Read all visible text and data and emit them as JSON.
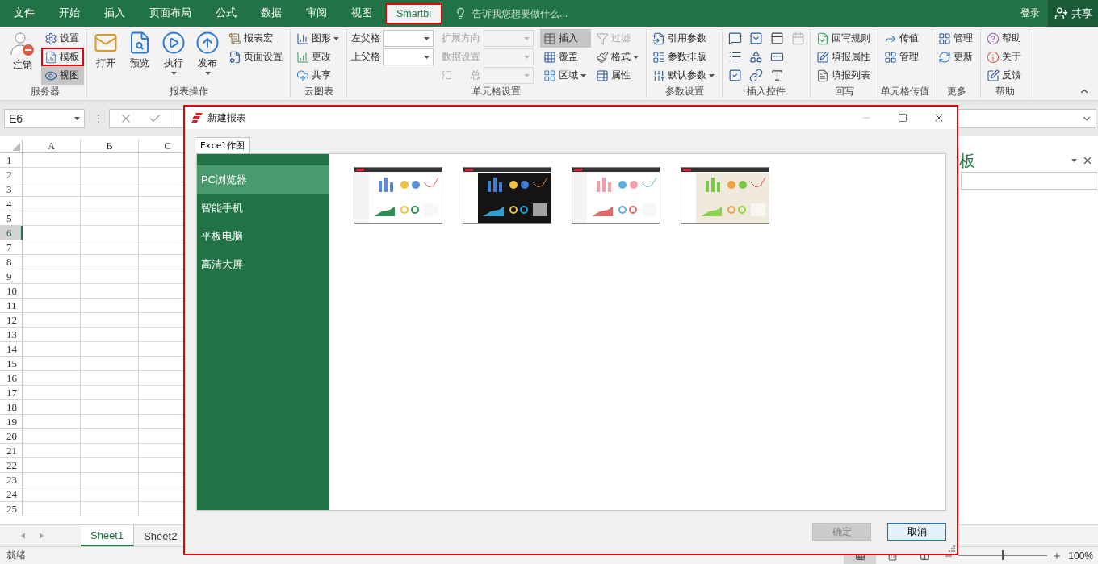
{
  "title_tabs": [
    {
      "label": "文件",
      "selected": false
    },
    {
      "label": "开始",
      "selected": false
    },
    {
      "label": "插入",
      "selected": false
    },
    {
      "label": "页面布局",
      "selected": false
    },
    {
      "label": "公式",
      "selected": false
    },
    {
      "label": "数据",
      "selected": false
    },
    {
      "label": "审阅",
      "selected": false
    },
    {
      "label": "视图",
      "selected": false
    },
    {
      "label": "Smartbi",
      "selected": true,
      "highlighted": true
    }
  ],
  "tell_me": {
    "placeholder": "告诉我您想要做什么..."
  },
  "account": {
    "sign_in": "登录",
    "share": "共享"
  },
  "ribbon": {
    "groups": [
      {
        "label": "服务器",
        "columns": [
          [
            {
              "kind": "large",
              "label": "注销"
            }
          ],
          [
            {
              "kind": "small",
              "label": "设置"
            },
            {
              "kind": "small",
              "label": "模板",
              "highlighted": true
            },
            {
              "kind": "small",
              "label": "视图",
              "pressed": true
            }
          ]
        ]
      },
      {
        "label": "报表操作",
        "columns": [
          [
            {
              "kind": "large",
              "label": "打开"
            }
          ],
          [
            {
              "kind": "large",
              "label": "预览"
            }
          ],
          [
            {
              "kind": "large",
              "label": "执行",
              "dropdown": true
            }
          ],
          [
            {
              "kind": "large",
              "label": "发布",
              "dropdown": true
            }
          ],
          [
            {
              "kind": "small",
              "label": "报表宏"
            },
            {
              "kind": "small",
              "label": "页面设置"
            }
          ]
        ]
      },
      {
        "label": "云图表",
        "columns": [
          [
            {
              "kind": "small",
              "label": "图形",
              "dropdown": true
            },
            {
              "kind": "small",
              "label": "更改"
            },
            {
              "kind": "small",
              "label": "共享"
            }
          ]
        ]
      },
      {
        "label": "单元格设置",
        "columns": [
          [
            {
              "kind": "combo",
              "label": "左父格"
            },
            {
              "kind": "combo",
              "label": "上父格"
            }
          ],
          [
            {
              "kind": "combo",
              "label": "扩展方向",
              "disabled": true
            },
            {
              "kind": "combo",
              "label": "数据设置",
              "disabled": true
            },
            {
              "kind": "combo",
              "label": "汇　　总",
              "disabled": true
            }
          ],
          [
            {
              "kind": "small",
              "label": "插入",
              "pressed": true
            },
            {
              "kind": "small",
              "label": "覆盖"
            },
            {
              "kind": "small",
              "label": "区域",
              "dropdown": true
            }
          ],
          [
            {
              "kind": "small",
              "label": "过滤",
              "disabled": true
            },
            {
              "kind": "small",
              "label": "格式",
              "dropdown": true
            },
            {
              "kind": "small",
              "label": "属性"
            }
          ]
        ]
      },
      {
        "label": "参数设置",
        "columns": [
          [
            {
              "kind": "small",
              "label": "引用参数"
            },
            {
              "kind": "small",
              "label": "参数排版"
            },
            {
              "kind": "small",
              "label": "默认参数",
              "dropdown": true
            }
          ]
        ]
      },
      {
        "label": "插入控件",
        "columns": [
          [
            {
              "kind": "icon"
            },
            {
              "kind": "icon"
            },
            {
              "kind": "icon"
            }
          ],
          [
            {
              "kind": "icon"
            },
            {
              "kind": "icon"
            },
            {
              "kind": "icon"
            }
          ],
          [
            {
              "kind": "icon"
            },
            {
              "kind": "icon"
            },
            {
              "kind": "icon"
            }
          ],
          [
            {
              "kind": "icon",
              "disabled": true
            }
          ]
        ]
      },
      {
        "label": "回写",
        "columns": [
          [
            {
              "kind": "small",
              "label": "回写规则"
            },
            {
              "kind": "small",
              "label": "填报属性"
            },
            {
              "kind": "small",
              "label": "填报列表"
            }
          ]
        ]
      },
      {
        "label": "单元格传值",
        "columns": [
          [
            {
              "kind": "small",
              "label": "传值"
            },
            {
              "kind": "small",
              "label": "管理"
            }
          ]
        ]
      },
      {
        "label": "更多",
        "columns": [
          [
            {
              "kind": "small",
              "label": "管理"
            },
            {
              "kind": "small",
              "label": "更新"
            }
          ]
        ]
      },
      {
        "label": "帮助",
        "columns": [
          [
            {
              "kind": "small",
              "label": "帮助"
            },
            {
              "kind": "small",
              "label": "关于"
            },
            {
              "kind": "small",
              "label": "反馈"
            }
          ]
        ]
      }
    ]
  },
  "formula_bar": {
    "name_box": "E6"
  },
  "sheet": {
    "columns": [
      "A",
      "B",
      "C"
    ],
    "rows": [
      {
        "label": "1",
        "selected": false
      },
      {
        "label": "2",
        "selected": false
      },
      {
        "label": "3",
        "selected": false
      },
      {
        "label": "4",
        "selected": false
      },
      {
        "label": "5",
        "selected": false
      },
      {
        "label": "6",
        "selected": true
      },
      {
        "label": "7",
        "selected": false
      },
      {
        "label": "8",
        "selected": false
      },
      {
        "label": "9",
        "selected": false
      },
      {
        "label": "10",
        "selected": false
      },
      {
        "label": "11",
        "selected": false
      },
      {
        "label": "12",
        "selected": false
      },
      {
        "label": "13",
        "selected": false
      },
      {
        "label": "14",
        "selected": false
      },
      {
        "label": "15",
        "selected": false
      },
      {
        "label": "16",
        "selected": false
      },
      {
        "label": "17",
        "selected": false
      },
      {
        "label": "18",
        "selected": false
      },
      {
        "label": "19",
        "selected": false
      },
      {
        "label": "20",
        "selected": false
      },
      {
        "label": "21",
        "selected": false
      },
      {
        "label": "22",
        "selected": false
      },
      {
        "label": "23",
        "selected": false
      },
      {
        "label": "24",
        "selected": false
      },
      {
        "label": "25",
        "selected": false
      }
    ]
  },
  "task_pane": {
    "title": "板"
  },
  "sheet_tabs": [
    {
      "label": "Sheet1",
      "selected": true
    },
    {
      "label": "Sheet2",
      "selected": false
    }
  ],
  "status_bar": {
    "status": "就绪",
    "views": [
      {
        "selected": true
      },
      {
        "selected": false
      },
      {
        "selected": false
      }
    ],
    "zoom_slider": {
      "level": 0.5
    },
    "zoom": "100%"
  },
  "dialog": {
    "title": "新建报表",
    "highlighted": true,
    "tabs": [
      {
        "label": "Excel作图",
        "selected": true
      }
    ],
    "categories": [
      {
        "label": "PC浏览器",
        "selected": true
      },
      {
        "label": "智能手机",
        "selected": false
      },
      {
        "label": "平板电脑",
        "selected": false
      },
      {
        "label": "高清大屏",
        "selected": false
      }
    ],
    "buttons": [
      {
        "label": "确定",
        "disabled": true,
        "focused": false
      },
      {
        "label": "取消",
        "disabled": false,
        "focused": true
      }
    ]
  }
}
